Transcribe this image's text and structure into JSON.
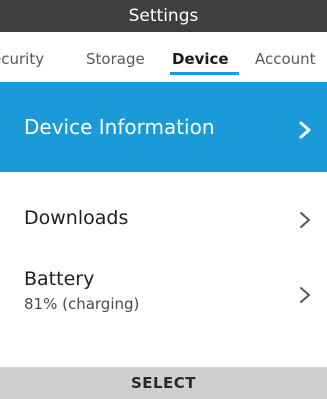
{
  "header": {
    "title": "Settings"
  },
  "tabs": {
    "items": [
      {
        "label": "ecurity",
        "selected": false
      },
      {
        "label": "Storage",
        "selected": false
      },
      {
        "label": "Device",
        "selected": true
      },
      {
        "label": "Account",
        "selected": false
      }
    ]
  },
  "menu": {
    "items": [
      {
        "label": "Device Information",
        "selected": true,
        "icon": "chevron-right-icon"
      },
      {
        "label": "Downloads",
        "selected": false,
        "icon": "chevron-right-icon"
      },
      {
        "label": "Battery",
        "sublabel": "81% (charging)",
        "selected": false,
        "icon": "chevron-right-icon"
      }
    ]
  },
  "softkey": {
    "center_label": "SELECT"
  },
  "colors": {
    "title_bar_bg": "#3f3f3f",
    "accent": "#1a9ad6",
    "softkey_bg": "#cfcfcf"
  }
}
